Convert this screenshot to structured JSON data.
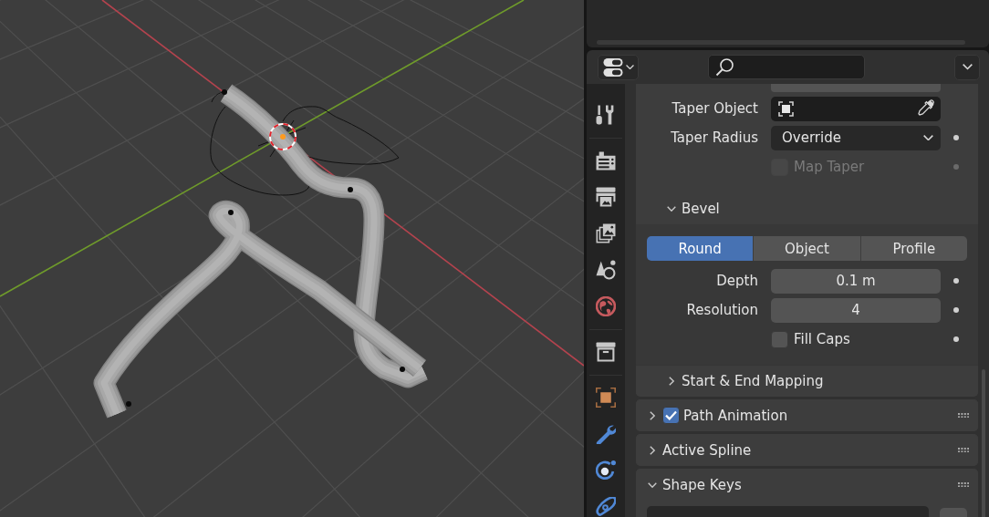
{
  "tab_groups": [
    {
      "tabs": [
        {
          "kind": "tool",
          "selected": false
        }
      ]
    },
    {
      "tabs": [
        {
          "kind": "render",
          "selected": false
        },
        {
          "kind": "output",
          "selected": false
        },
        {
          "kind": "view_layer",
          "selected": false
        },
        {
          "kind": "scene",
          "selected": false
        },
        {
          "kind": "world",
          "selected": false
        }
      ]
    },
    {
      "tabs": [
        {
          "kind": "collection",
          "selected": false
        }
      ]
    },
    {
      "tabs": [
        {
          "kind": "object",
          "selected": false
        },
        {
          "kind": "modifiers",
          "selected": false
        },
        {
          "kind": "particles",
          "selected": false
        },
        {
          "kind": "physics",
          "selected": false
        }
      ]
    }
  ],
  "geometry_panel": {
    "rows": [
      {
        "kind": "clipped"
      },
      {
        "kind": "object_field",
        "label": "Taper Object",
        "disabled": false,
        "keyframe": false
      },
      {
        "kind": "dropdown",
        "label": "Taper Radius",
        "value": "Override",
        "disabled": false,
        "keyframe": true
      },
      {
        "kind": "checkbox",
        "label": "Map Taper",
        "checked": false,
        "disabled": true,
        "keyframe": true
      }
    ],
    "subpanel": {
      "title": "Bevel",
      "expanded": true,
      "modes": [
        {
          "label": "Round",
          "selected": true
        },
        {
          "label": "Object",
          "selected": false
        },
        {
          "label": "Profile",
          "selected": false
        }
      ],
      "rows": [
        {
          "kind": "number",
          "label": "Depth",
          "value": "0.1 m",
          "disabled": false,
          "keyframe": true
        },
        {
          "kind": "number",
          "label": "Resolution",
          "value": "4",
          "disabled": false,
          "keyframe": true
        },
        {
          "kind": "checkbox",
          "label": "Fill Caps",
          "checked": false,
          "disabled": false,
          "keyframe": true
        }
      ],
      "subpanels": [
        {
          "title": "Start & End Mapping",
          "expanded": false
        }
      ]
    }
  },
  "panels": [
    {
      "title": "Path Animation",
      "expanded": false,
      "checkbox": {
        "checked": true
      }
    },
    {
      "title": "Active Spline",
      "expanded": false
    },
    {
      "title": "Shape Keys",
      "expanded": true
    }
  ]
}
